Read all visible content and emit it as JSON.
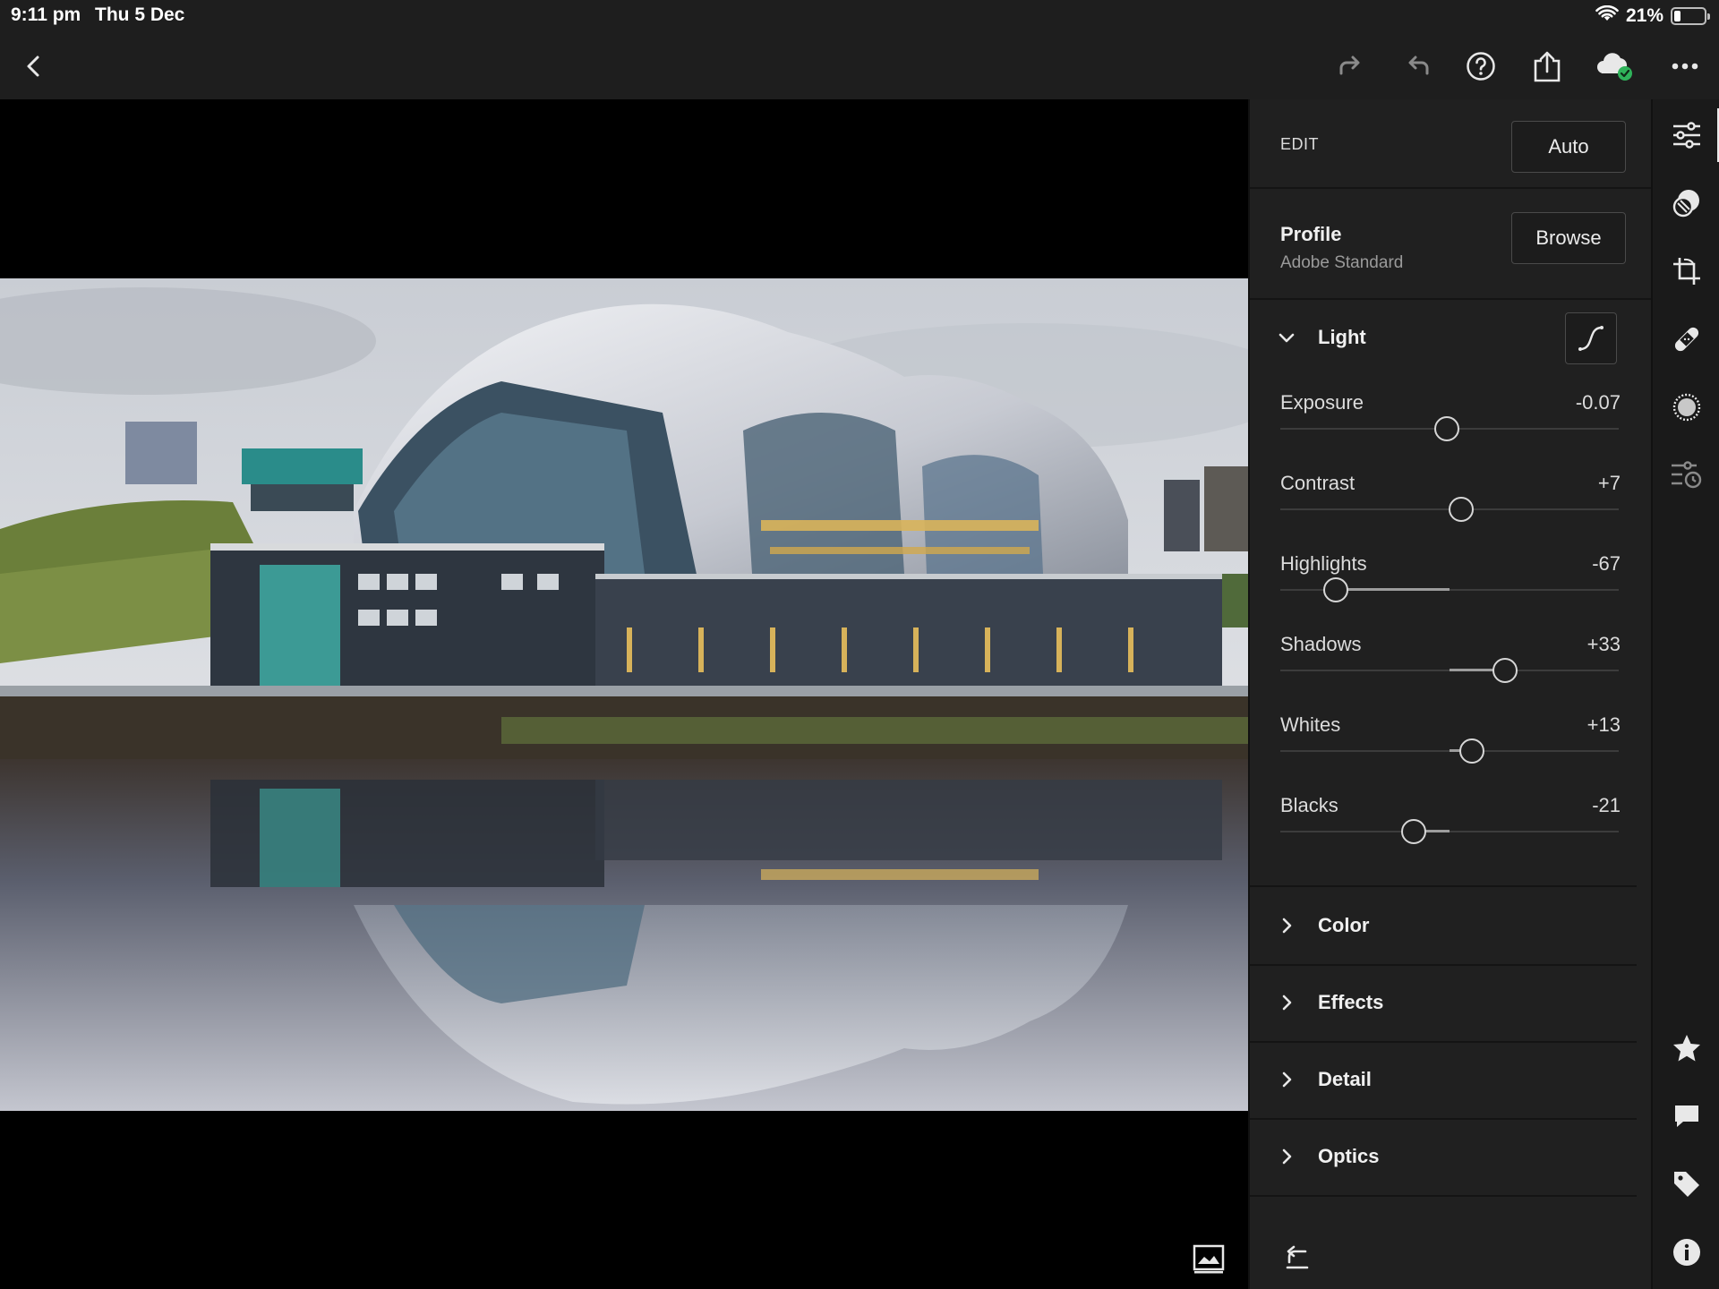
{
  "status_bar": {
    "time": "9:11 pm",
    "date": "Thu 5 Dec",
    "battery_text": "21%",
    "battery_level": 0.21
  },
  "toolbar": {
    "icons": [
      "back-chevron-icon",
      "redo-icon",
      "undo-icon",
      "help-icon",
      "share-icon",
      "cloud-synced-icon",
      "more-icon"
    ],
    "sync_color": "#2fb35a"
  },
  "edit": {
    "header_label": "EDIT",
    "auto_label": "Auto",
    "profile": {
      "title": "Profile",
      "value": "Adobe Standard",
      "browse_label": "Browse"
    },
    "light": {
      "title": "Light",
      "expanded": true,
      "sliders": [
        {
          "name": "Exposure",
          "display": "-0.07",
          "value": -0.07,
          "min": -5,
          "max": 5
        },
        {
          "name": "Contrast",
          "display": "+7",
          "value": 7,
          "min": -100,
          "max": 100
        },
        {
          "name": "Highlights",
          "display": "-67",
          "value": -67,
          "min": -100,
          "max": 100
        },
        {
          "name": "Shadows",
          "display": "+33",
          "value": 33,
          "min": -100,
          "max": 100
        },
        {
          "name": "Whites",
          "display": "+13",
          "value": 13,
          "min": -100,
          "max": 100
        },
        {
          "name": "Blacks",
          "display": "-21",
          "value": -21,
          "min": -100,
          "max": 100
        }
      ]
    },
    "collapsed_sections": [
      "Color",
      "Effects",
      "Detail",
      "Optics"
    ]
  },
  "rail": {
    "icons": [
      "edit-sliders-icon",
      "presets-icon",
      "crop-icon",
      "healing-icon",
      "masking-icon",
      "versions-icon",
      "star-icon",
      "comment-icon",
      "tag-icon",
      "info-icon"
    ],
    "active": "edit-sliders-icon"
  },
  "photo": {
    "alt": "Sage Gateshead building reflected in the River Tyne"
  }
}
